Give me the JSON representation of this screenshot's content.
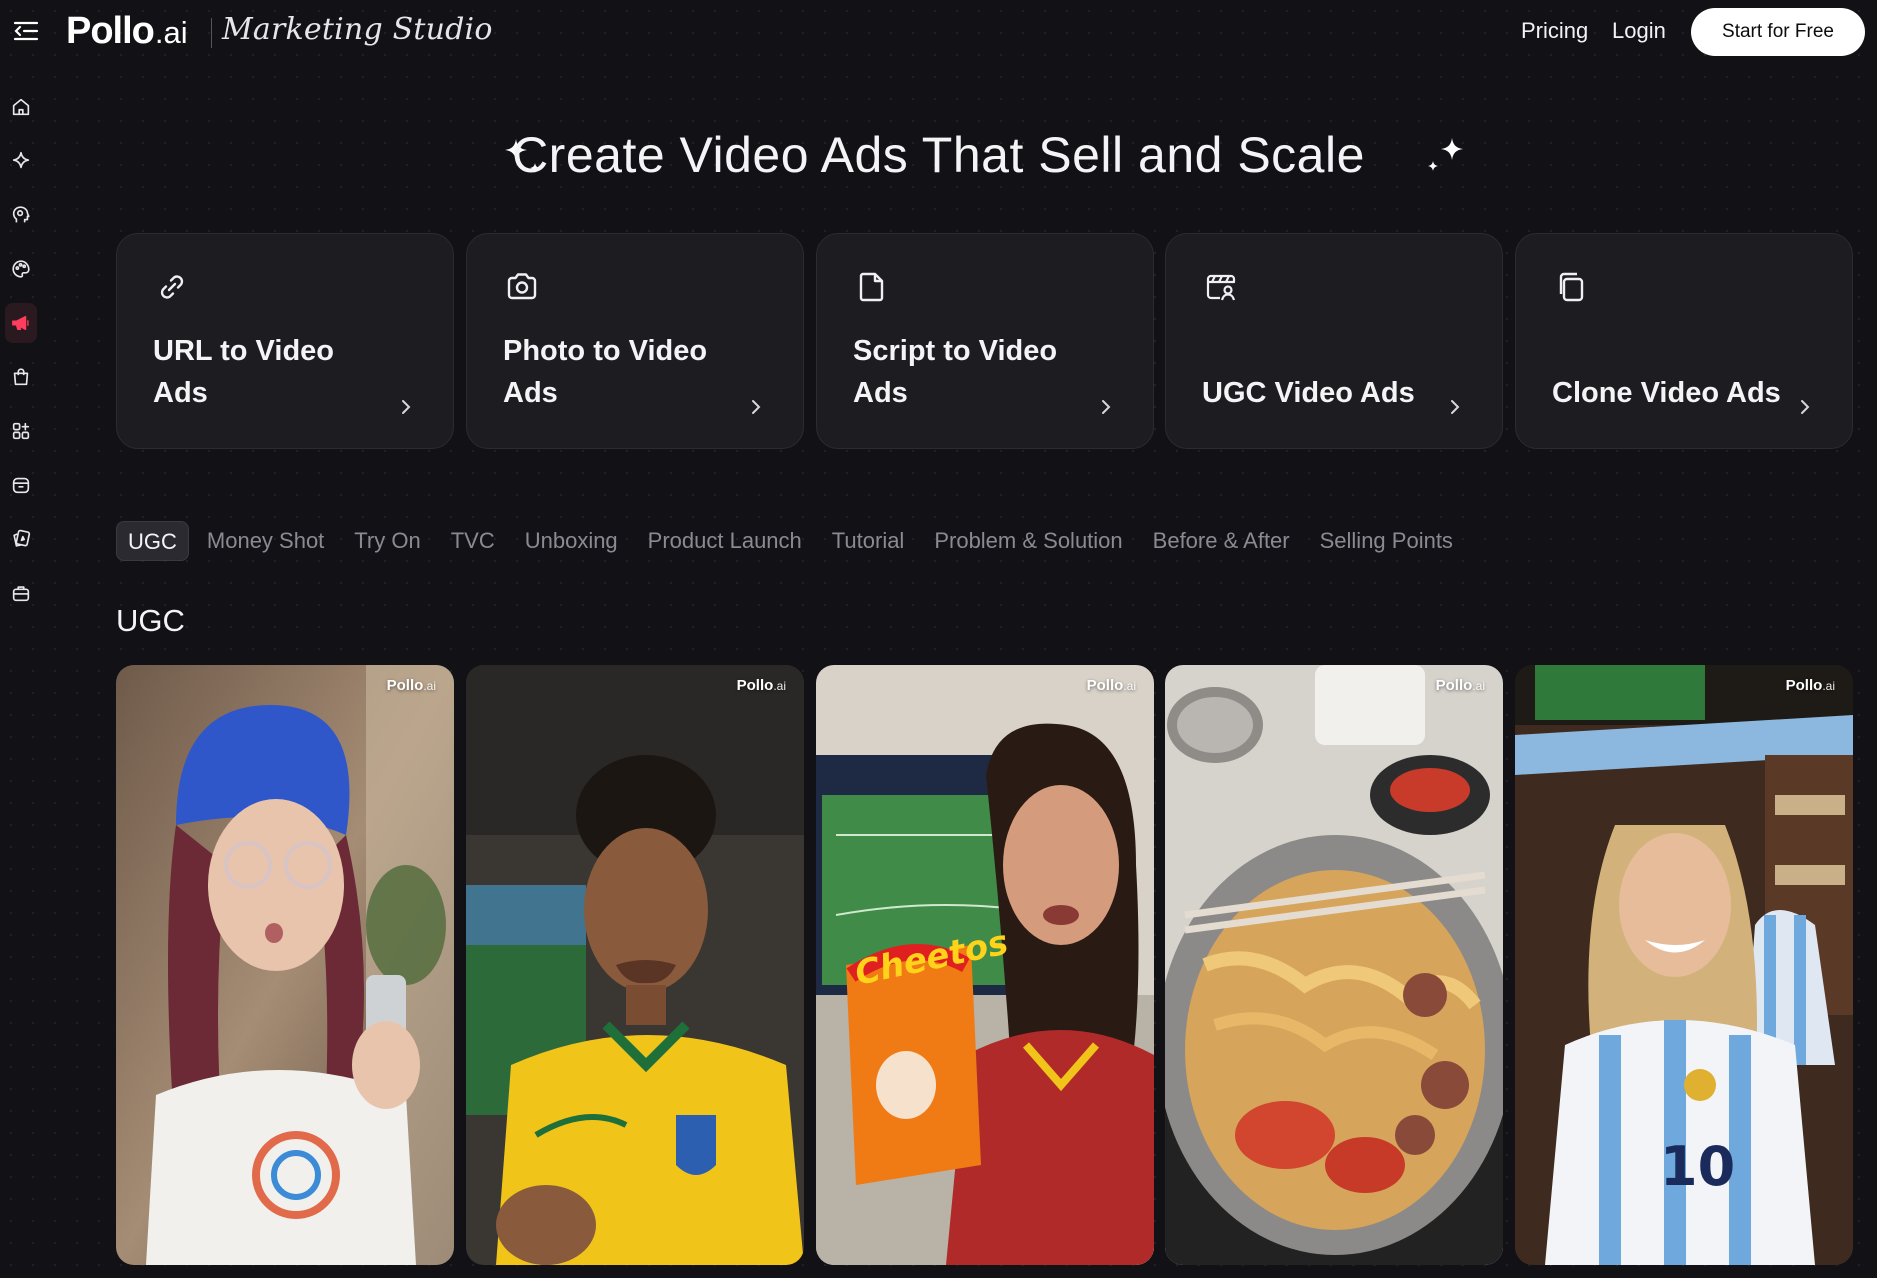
{
  "header": {
    "brand": "Pollo",
    "brand_suffix": ".ai",
    "studio_title": "Marketing Studio",
    "nav": {
      "pricing": "Pricing",
      "login": "Login"
    },
    "cta": "Start for Free"
  },
  "sidebar": {
    "items": [
      {
        "icon": "home-icon"
      },
      {
        "icon": "sparkle-icon"
      },
      {
        "icon": "head-profile-icon"
      },
      {
        "icon": "palette-icon"
      },
      {
        "icon": "megaphone-icon",
        "active": true
      },
      {
        "icon": "shopping-bag-icon"
      },
      {
        "icon": "apps-grid-icon"
      },
      {
        "icon": "box-icon"
      },
      {
        "icon": "cards-icon"
      },
      {
        "icon": "toolbox-icon"
      }
    ],
    "active_color": "#ff3d5e"
  },
  "hero": {
    "title": "Create Video Ads That Sell and Scale"
  },
  "cards": [
    {
      "label": "URL to Video Ads",
      "icon": "link-icon"
    },
    {
      "label": "Photo to Video Ads",
      "icon": "camera-icon"
    },
    {
      "label": "Script to Video Ads",
      "icon": "document-icon"
    },
    {
      "label": "UGC Video Ads",
      "icon": "clapper-user-icon"
    },
    {
      "label": "Clone Video Ads",
      "icon": "copy-icon"
    }
  ],
  "tabs": [
    {
      "label": "UGC",
      "active": true
    },
    {
      "label": "Money Shot"
    },
    {
      "label": "Try On"
    },
    {
      "label": "TVC"
    },
    {
      "label": "Unboxing"
    },
    {
      "label": "Product Launch"
    },
    {
      "label": "Tutorial"
    },
    {
      "label": "Problem & Solution"
    },
    {
      "label": "Before & After"
    },
    {
      "label": "Selling Points"
    }
  ],
  "section": {
    "title": "UGC"
  },
  "videos": [
    {
      "watermark_brand": "Pollo",
      "watermark_suffix": ".ai"
    },
    {
      "watermark_brand": "Pollo",
      "watermark_suffix": ".ai"
    },
    {
      "watermark_brand": "Pollo",
      "watermark_suffix": ".ai"
    },
    {
      "watermark_brand": "Pollo",
      "watermark_suffix": ".ai"
    },
    {
      "watermark_brand": "Pollo",
      "watermark_suffix": ".ai"
    }
  ],
  "colors": {
    "background": "#121216",
    "card_bg": "#1c1c21",
    "cta_bg": "#ffffff"
  }
}
